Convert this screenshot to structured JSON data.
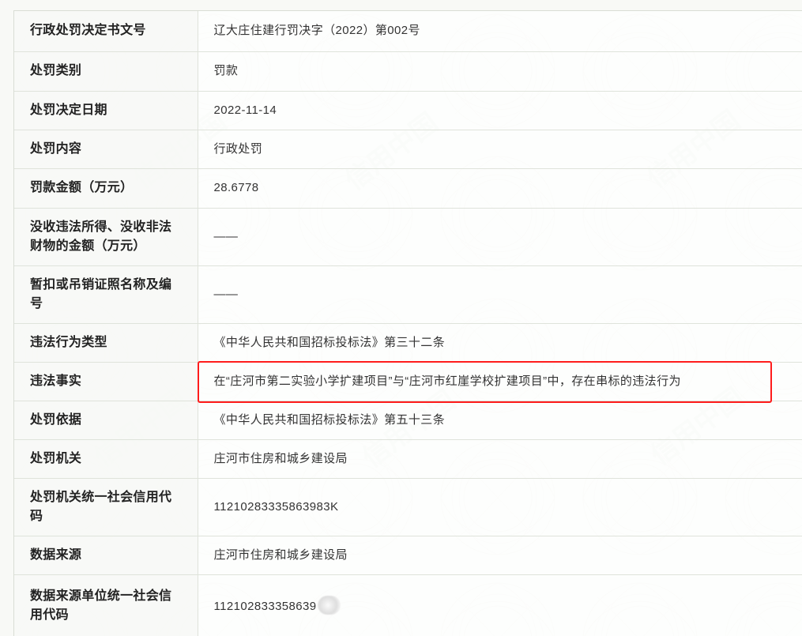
{
  "watermark": {
    "text": "信用中国"
  },
  "rows": [
    {
      "label": "行政处罚决定书文号",
      "value": "辽大庄住建行罚决字（2022）第002号"
    },
    {
      "label": "处罚类别",
      "value": "罚款"
    },
    {
      "label": "处罚决定日期",
      "value": "2022-11-14"
    },
    {
      "label": "处罚内容",
      "value": "行政处罚"
    },
    {
      "label": "罚款金额（万元）",
      "value": "28.6778"
    },
    {
      "label": "没收违法所得、没收非法财物的金额（万元）",
      "value": "——"
    },
    {
      "label": "暂扣或吊销证照名称及编号",
      "value": "——"
    },
    {
      "label": "违法行为类型",
      "value": "《中华人民共和国招标投标法》第三十二条"
    },
    {
      "label": "违法事实",
      "value": "在“庄河市第二实验小学扩建项目”与“庄河市红崖学校扩建项目”中，存在串标的违法行为"
    },
    {
      "label": "处罚依据",
      "value": "《中华人民共和国招标投标法》第五十三条"
    },
    {
      "label": "处罚机关",
      "value": "庄河市住房和城乡建设局"
    },
    {
      "label": "处罚机关统一社会信用代码",
      "value": "11210283335863983K"
    },
    {
      "label": "数据来源",
      "value": "庄河市住房和城乡建设局"
    },
    {
      "label": "数据来源单位统一社会信用代码",
      "value": "112102833358639"
    }
  ],
  "colors": {
    "highlight": "#ff1c1c",
    "watermark": "#e8ece3",
    "border": "#dfe3db"
  }
}
